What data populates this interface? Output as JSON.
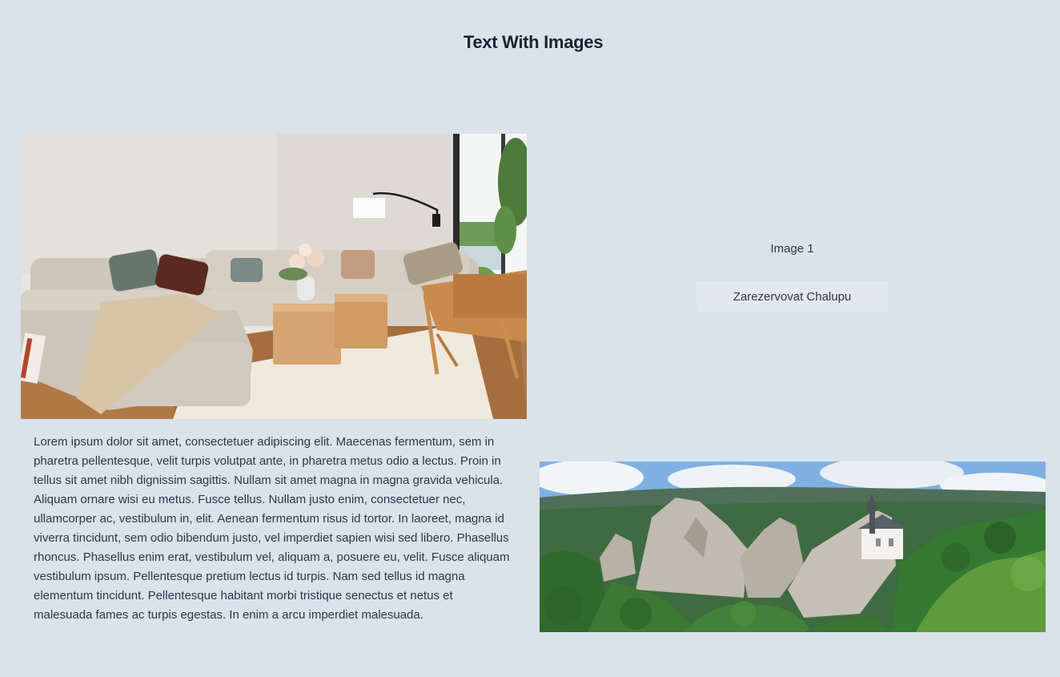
{
  "page": {
    "title": "Text With Images"
  },
  "section_1": {
    "image_label": "Image 1",
    "button_label": "Zarezervovat Chalupu",
    "living_room_image": "living-room-photo",
    "landscape_image": "rock-castle-landscape-photo"
  },
  "section_2": {
    "body_text": "Lorem ipsum dolor sit amet, consectetuer adipiscing elit. Maecenas fermentum, sem in pharetra pellentesque, velit turpis volutpat ante, in pharetra metus odio a lectus. Proin in tellus sit amet nibh dignissim sagittis. Nullam sit amet magna in magna gravida vehicula. Aliquam ornare wisi eu metus. Fusce tellus. Nullam justo enim, consectetuer nec, ullamcorper ac, vestibulum in, elit. Aenean fermentum risus id tortor. In laoreet, magna id viverra tincidunt, sem odio bibendum justo, vel imperdiet sapien wisi sed libero. Phasellus rhoncus. Phasellus enim erat, vestibulum vel, aliquam a, posuere eu, velit. Fusce aliquam vestibulum ipsum. Pellentesque pretium lectus id turpis. Nam sed tellus id magna elementum tincidunt. Pellentesque habitant morbi tristique senectus et netus et malesuada fames ac turpis egestas. In enim a arcu imperdiet malesuada."
  },
  "colors": {
    "background": "#dae2ea",
    "button_background": "#e2e8ee",
    "title_text": "#1a2332",
    "body_text": "#2d3748"
  }
}
